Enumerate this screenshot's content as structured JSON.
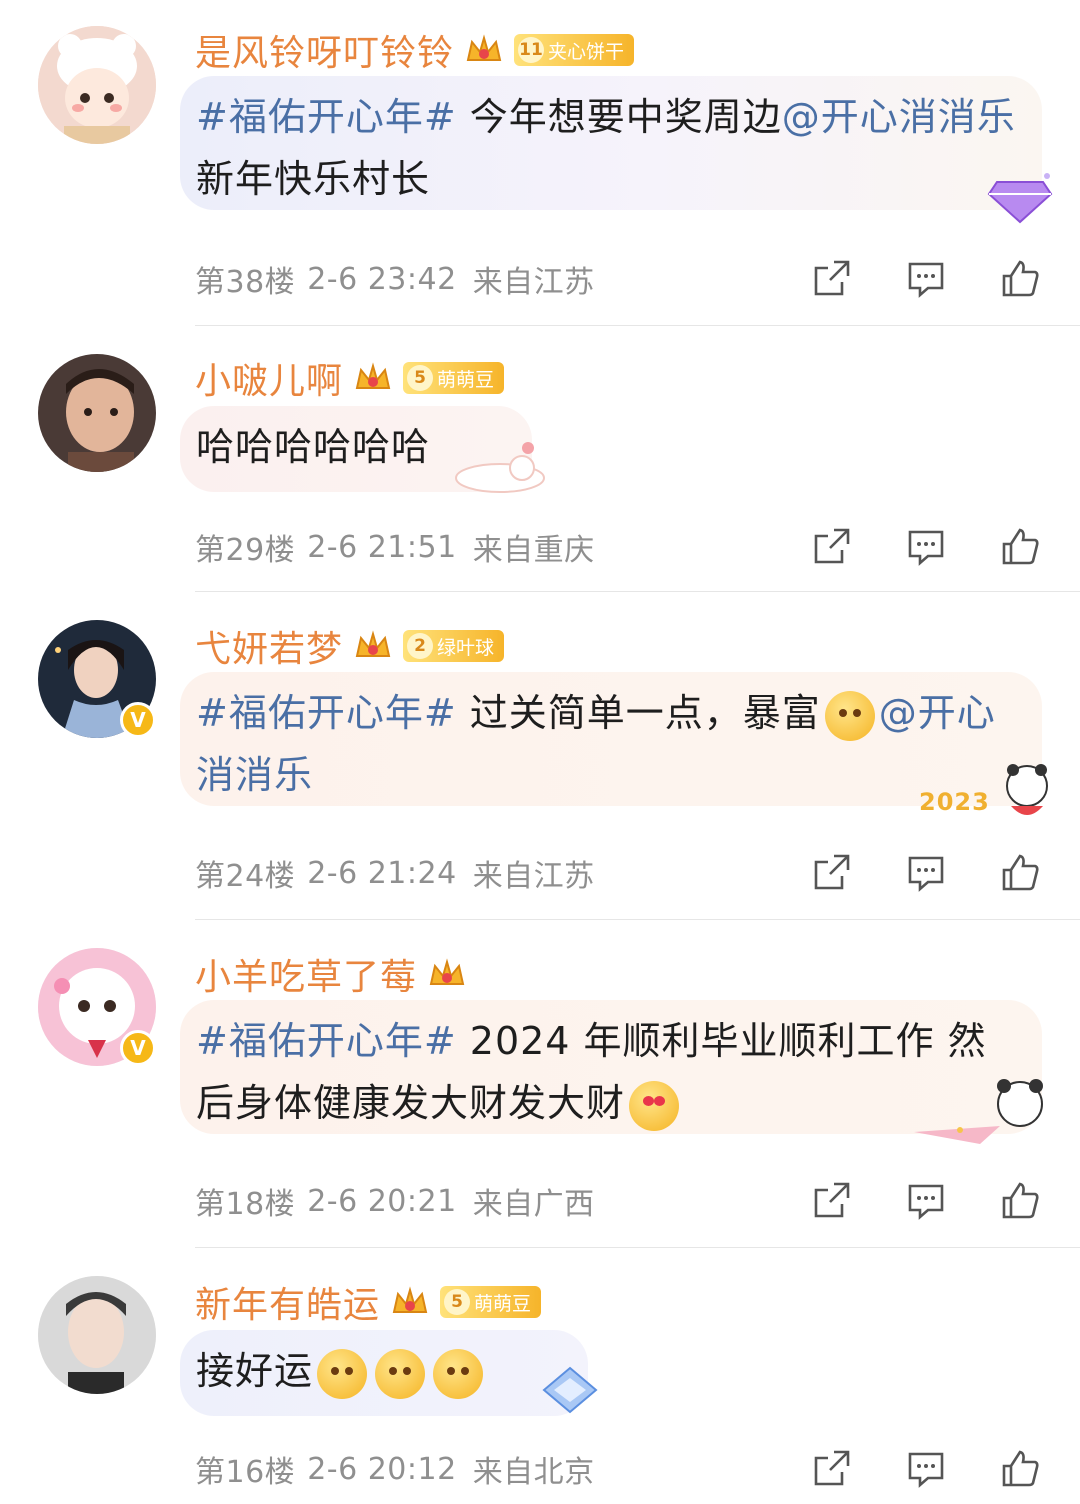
{
  "comments": [
    {
      "username": "是风铃呀叮铃铃",
      "fan_level": "11",
      "fan_badge": "夹心饼干",
      "verified": false,
      "content": [
        {
          "type": "topic",
          "text": "#福佑开心年#"
        },
        {
          "type": "text",
          "text": " 今年想要中奖周边"
        },
        {
          "type": "mention",
          "text": "@开心消消乐"
        },
        {
          "type": "text",
          "text": " 新年快乐村长"
        }
      ],
      "floor": "第38楼",
      "datetime": "2-6 23:42",
      "location": "来自江苏"
    },
    {
      "username": "小啵儿啊",
      "fan_level": "5",
      "fan_badge": "萌萌豆",
      "verified": false,
      "content": [
        {
          "type": "text",
          "text": "哈哈哈哈哈哈"
        }
      ],
      "floor": "第29楼",
      "datetime": "2-6 21:51",
      "location": "来自重庆"
    },
    {
      "username": "弋妍若梦",
      "fan_level": "2",
      "fan_badge": "绿叶球",
      "verified": true,
      "content": [
        {
          "type": "topic",
          "text": "#福佑开心年#"
        },
        {
          "type": "text",
          "text": " 过关简单一点，暴富"
        },
        {
          "type": "emoji",
          "text": "rainbow-kiss-emoji"
        },
        {
          "type": "mention",
          "text": "@开心消消乐"
        }
      ],
      "floor": "第24楼",
      "datetime": "2-6 21:24",
      "location": "来自江苏"
    },
    {
      "username": "小羊吃草了莓",
      "fan_level": "",
      "fan_badge": "",
      "verified": true,
      "content": [
        {
          "type": "topic",
          "text": "#福佑开心年#"
        },
        {
          "type": "text",
          "text": " 2024 年顺利毕业顺利工作 然后身体健康发大财发大财"
        },
        {
          "type": "emoji",
          "text": "heart-eyes-emoji"
        }
      ],
      "floor": "第18楼",
      "datetime": "2-6 20:21",
      "location": "来自广西"
    },
    {
      "username": "新年有皓运",
      "fan_level": "5",
      "fan_badge": "萌萌豆",
      "verified": false,
      "content": [
        {
          "type": "text",
          "text": "接好运"
        },
        {
          "type": "emoji",
          "text": "blush-emoji"
        },
        {
          "type": "emoji",
          "text": "blush-emoji"
        },
        {
          "type": "emoji",
          "text": "blush-emoji"
        }
      ],
      "floor": "第16楼",
      "datetime": "2-6 20:12",
      "location": "来自北京"
    }
  ],
  "deco_text": "2023",
  "colors": {
    "username": "#e8853e",
    "topic_link": "#4a6fa5",
    "meta": "#8f8f8f",
    "badge_gold": "#f6b42a"
  }
}
